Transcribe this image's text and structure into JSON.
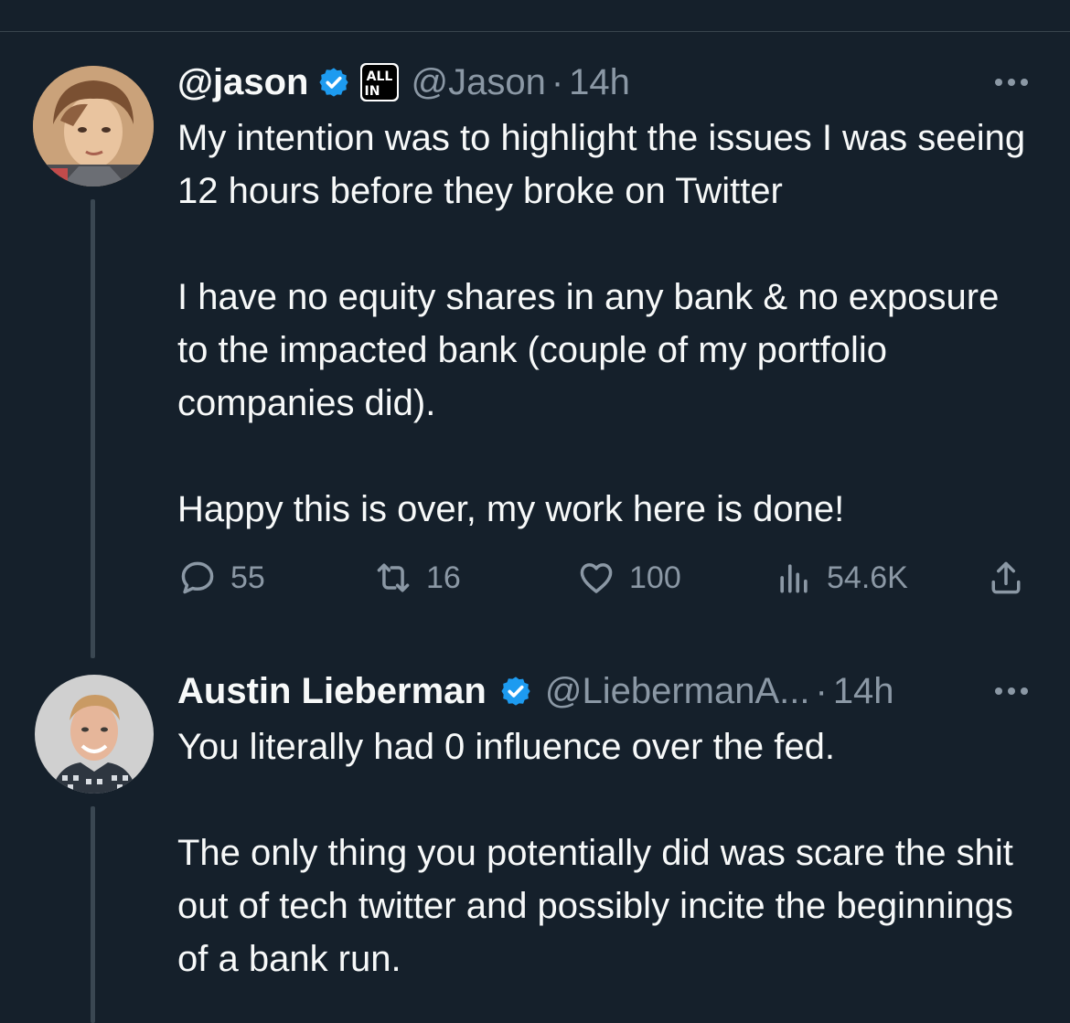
{
  "colors": {
    "background": "#15202b",
    "text_primary": "#f7f9f9",
    "text_secondary": "#8b98a5",
    "verified_blue": "#1d9bf0",
    "divider": "#38444d"
  },
  "tweets": [
    {
      "display_name": "@jason",
      "verified": true,
      "affiliation_badge": "ALL IN",
      "handle": "@Jason",
      "separator": "·",
      "time": "14h",
      "paragraphs": [
        "My intention was to highlight the issues I was seeing 12 hours before they broke on Twitter",
        "I have no equity shares in any bank & no exposure to the impacted bank (couple of my portfolio companies did).",
        "Happy this is over, my work here is done!"
      ],
      "actions": {
        "replies": "55",
        "retweets": "16",
        "likes": "100",
        "views": "54.6K"
      },
      "icons": [
        "more-icon",
        "reply-icon",
        "retweet-icon",
        "like-icon",
        "views-icon",
        "share-icon"
      ]
    },
    {
      "display_name": "Austin Lieberman",
      "verified": true,
      "handle": "@LiebermanA...",
      "separator": "·",
      "time": "14h",
      "paragraphs": [
        "You literally had 0 influence over the fed.",
        "The only thing you potentially did was scare the shit out of tech twitter and possibly incite the beginnings of a bank run."
      ],
      "icons": [
        "more-icon"
      ]
    }
  ]
}
